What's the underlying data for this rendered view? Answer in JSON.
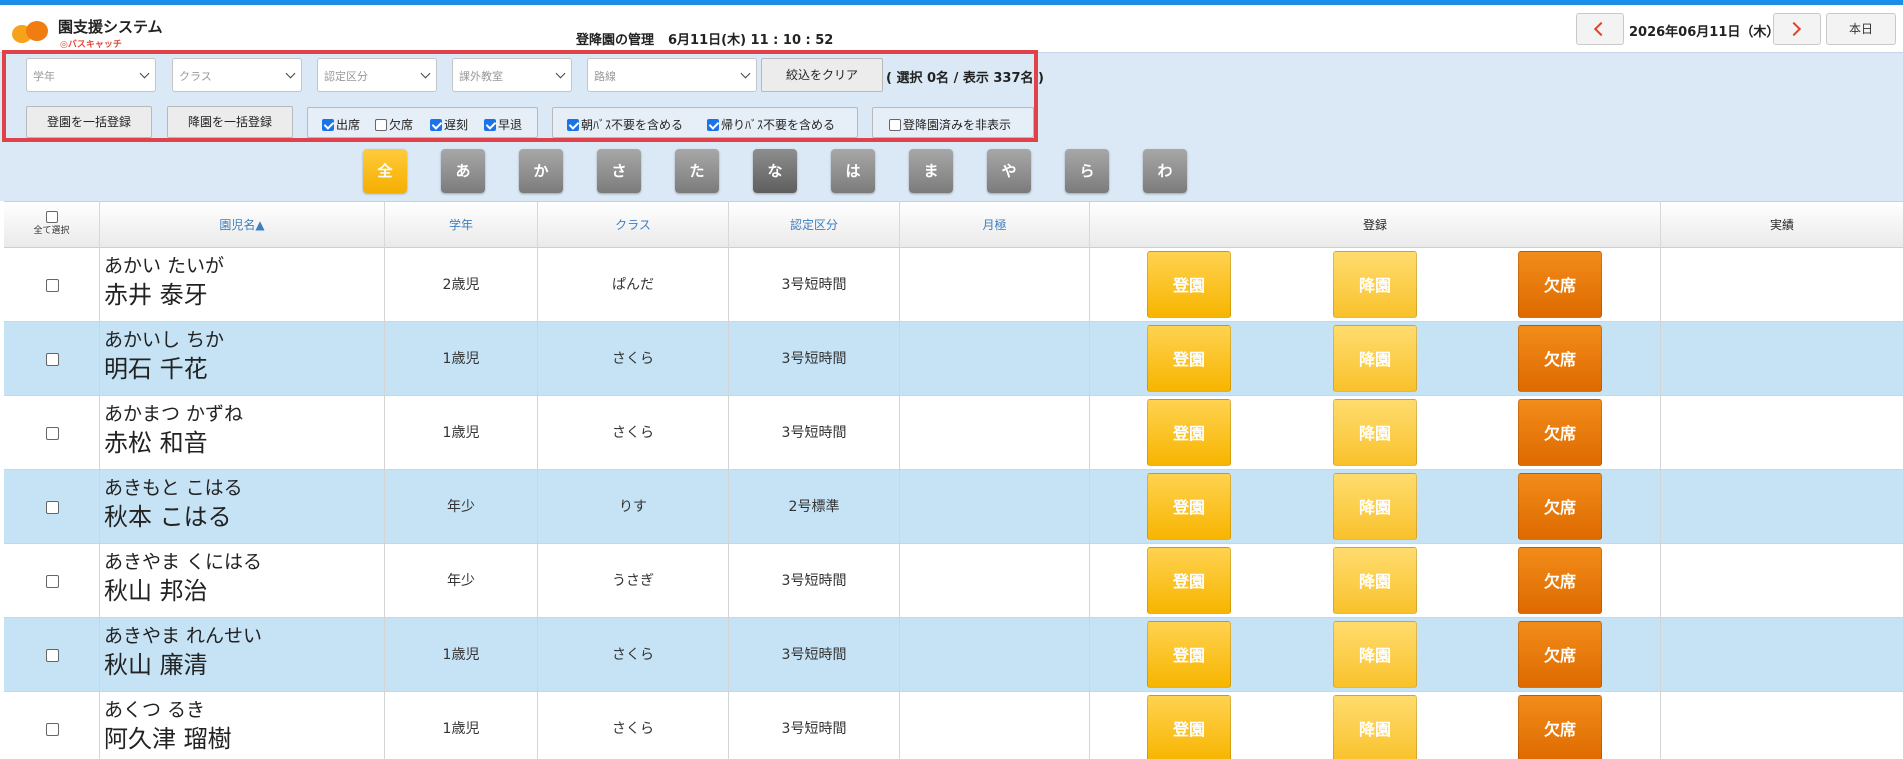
{
  "app": {
    "title": "園支援システム",
    "subtitle": "◎バスキャッチ",
    "brand_colors": [
      "#f7a21b",
      "#f17c12"
    ]
  },
  "header": {
    "page_title": "登降園の管理",
    "datetime": "6月11日(木) 11 : 10 : 52",
    "current_date": "2026年06月11日（木）",
    "today_label": "本日",
    "prev_icon": "chevron-left-icon",
    "next_icon": "chevron-right-icon"
  },
  "filters": {
    "grade_placeholder": "学年",
    "class_placeholder": "クラス",
    "certification_placeholder": "認定区分",
    "extracurricular_placeholder": "課外教室",
    "route_placeholder": "路線",
    "clear_label": "絞込をクリア",
    "count_text": "( 選択 0名 / 表示 337名 )",
    "bulk_arrival_label": "登園を一括登録",
    "bulk_departure_label": "降園を一括登録",
    "status_checks": [
      {
        "label": "出席",
        "checked": true
      },
      {
        "label": "欠席",
        "checked": false
      },
      {
        "label": "遅刻",
        "checked": true
      },
      {
        "label": "早退",
        "checked": true
      }
    ],
    "bus_checks": [
      {
        "label": "朝ﾊﾞｽ不要を含める",
        "checked": true
      },
      {
        "label": "帰りﾊﾞｽ不要を含める",
        "checked": true
      }
    ],
    "hide_registered": {
      "label": "登降園済みを非表示",
      "checked": false
    },
    "highlight_color": "#e0424a"
  },
  "kana_tabs": [
    "全",
    "あ",
    "か",
    "さ",
    "た",
    "な",
    "は",
    "ま",
    "や",
    "ら",
    "わ"
  ],
  "table": {
    "headers": {
      "select_all": "全て選択",
      "name": "園児名▲",
      "grade": "学年",
      "class": "クラス",
      "certification": "認定区分",
      "monthly": "月極",
      "register": "登録",
      "record": "実績"
    },
    "action_labels": {
      "arrive": "登園",
      "depart": "降園",
      "absent": "欠席"
    },
    "rows": [
      {
        "kana": "あかい たいが",
        "name": "赤井 泰牙",
        "grade": "2歳児",
        "class": "ぱんだ",
        "cert": "3号短時間"
      },
      {
        "kana": "あかいし ちか",
        "name": "明石 千花",
        "grade": "1歳児",
        "class": "さくら",
        "cert": "3号短時間"
      },
      {
        "kana": "あかまつ かずね",
        "name": "赤松 和音",
        "grade": "1歳児",
        "class": "さくら",
        "cert": "3号短時間"
      },
      {
        "kana": "あきもと こはる",
        "name": "秋本 こはる",
        "grade": "年少",
        "class": "りす",
        "cert": "2号標準"
      },
      {
        "kana": "あきやま くにはる",
        "name": "秋山 邦治",
        "grade": "年少",
        "class": "うさぎ",
        "cert": "3号短時間"
      },
      {
        "kana": "あきやま れんせい",
        "name": "秋山 廉清",
        "grade": "1歳児",
        "class": "さくら",
        "cert": "3号短時間"
      },
      {
        "kana": "あくつ るき",
        "name": "阿久津 瑠樹",
        "grade": "1歳児",
        "class": "さくら",
        "cert": "3号短時間"
      }
    ]
  }
}
